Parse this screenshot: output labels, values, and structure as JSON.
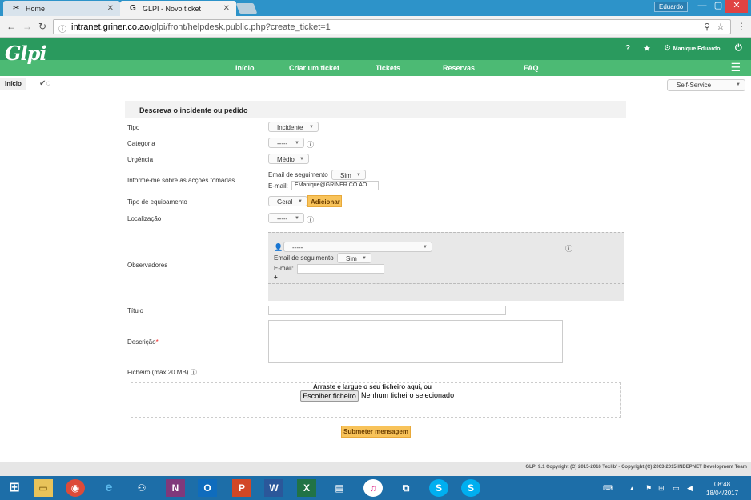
{
  "browser": {
    "tabs": [
      {
        "label": "Home",
        "active": false
      },
      {
        "label": "GLPI - Novo ticket",
        "active": true
      }
    ],
    "user_chip": "Eduardo",
    "url_host": "intranet.griner.co.ao",
    "url_path": "/glpi/front/helpdesk.public.php?create_ticket=1"
  },
  "header": {
    "logo": "Glpi",
    "help": "?",
    "user": "Manique Eduardo",
    "nav": [
      "Início",
      "Criar um ticket",
      "Tickets",
      "Reservas",
      "FAQ"
    ]
  },
  "breadcrumb": {
    "home": "Início"
  },
  "profile": {
    "selected": "Self-Service"
  },
  "form": {
    "title": "Descreva o incidente ou pedido",
    "tipo_label": "Tipo",
    "tipo_value": "Incidente",
    "categoria_label": "Categoria",
    "categoria_value": "-----",
    "urgencia_label": "Urgência",
    "urgencia_value": "Médio",
    "informe_label": "Informe-me sobre as acções tomadas",
    "email_seg_label": "Email de seguimento",
    "email_seg_value": "Sim",
    "email_label": "E-mail:",
    "email_value": "EManique@GRINER.CO.AO",
    "equip_label": "Tipo de equipamento",
    "equip_value": "Geral",
    "add_button": "Adicionar",
    "local_label": "Localização",
    "local_value": "-----",
    "obs_label": "Observadores",
    "obs_value": "-----",
    "obs_email_seg_label": "Email de seguimento",
    "obs_email_seg_value": "Sim",
    "obs_email_label": "E-mail:",
    "obs_add": "+",
    "titulo_label": "Título",
    "descricao_label": "Descrição",
    "descricao_req": "*",
    "ficheiro_label": "Ficheiro (máx 20 MB)",
    "dropzone_text": "Arraste e largue o seu ficheiro aqui, ou",
    "choose_file": "Escolher ficheiro",
    "no_file": "Nenhum ficheiro selecionado",
    "submit": "Submeter mensagem"
  },
  "footer": {
    "text": "GLPI 9.1 Copyright (C) 2015-2016 Teclib' - Copyright (C) 2003-2015 INDEPNET Development Team"
  },
  "taskbar": {
    "time": "08:48",
    "date": "18/04/2017"
  },
  "colors": {
    "header": "#2a9a5e",
    "nav": "#4cba74",
    "button": "#f8c35a",
    "taskbar": "#1d6ea8"
  }
}
